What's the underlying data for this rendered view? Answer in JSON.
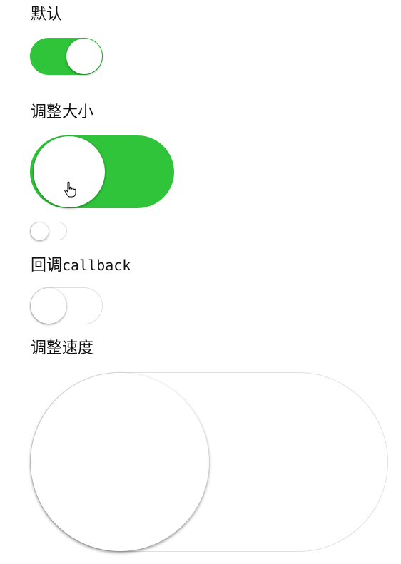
{
  "sections": {
    "default_label": "默认",
    "resize_label": "调整大小",
    "callback_label_prefix": "回调",
    "callback_label_code": "callback",
    "speed_label": "调整速度"
  },
  "switches": {
    "default": {
      "checked": true
    },
    "large": {
      "checked": true
    },
    "small": {
      "checked": false
    },
    "callback": {
      "checked": false
    },
    "speed": {
      "checked": false
    }
  },
  "colors": {
    "on": "#2fc43a",
    "off_border": "#dfdfdf",
    "knob": "#ffffff"
  },
  "icons": {
    "cursor": "hand-pointer-icon"
  }
}
